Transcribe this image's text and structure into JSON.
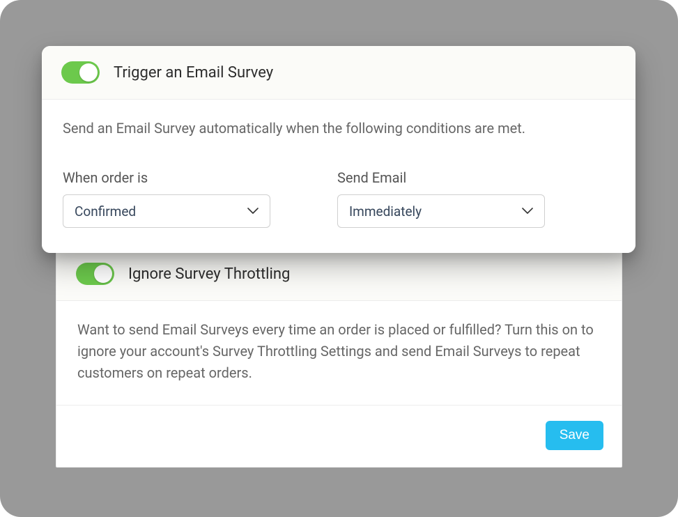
{
  "trigger_section": {
    "toggle_on": true,
    "title": "Trigger an Email Survey",
    "description": "Send an Email Survey automatically when the following conditions are met.",
    "fields": {
      "order_status": {
        "label": "When order is",
        "value": "Confirmed"
      },
      "send_email": {
        "label": "Send Email",
        "value": "Immediately"
      }
    }
  },
  "throttling_section": {
    "toggle_on": true,
    "title": "Ignore Survey Throttling",
    "description": "Want to send Email Surveys every time an order is placed or fulfilled? Turn this on to ignore your account's Survey Throttling Settings and send Email Surveys to repeat customers on repeat orders."
  },
  "footer": {
    "save_label": "Save"
  }
}
